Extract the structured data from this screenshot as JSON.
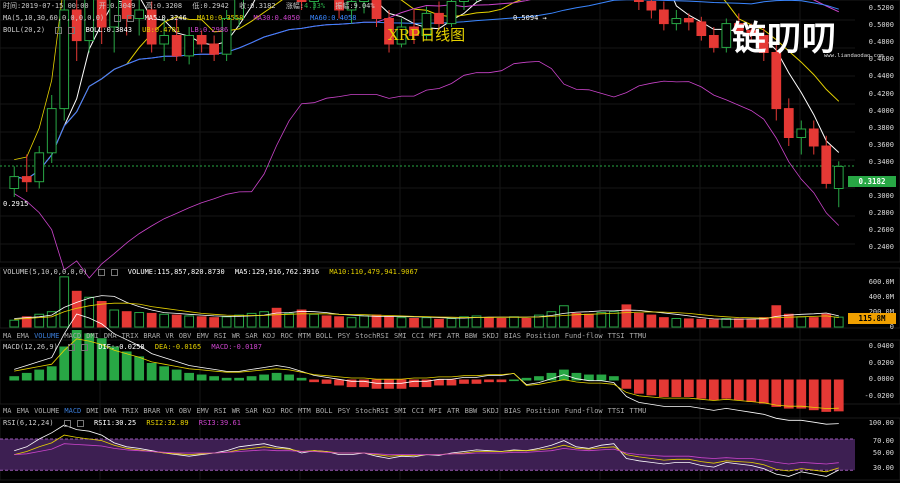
{
  "title": "XRP日线图",
  "logo": {
    "text": "链叨叨",
    "url": "www.liandaodao.com"
  },
  "header": {
    "time_label": "时间:2019-07-15 00:00",
    "open": "开:0.3049",
    "high": "高:0.3208",
    "low": "低:0.2942",
    "close": "收:0.3182",
    "change_label": "涨幅:",
    "change_value": "4.33%",
    "amplitude": "振幅:9.04%"
  },
  "ma_header": {
    "name": "MA(5,10,30,60,0,0,0,0,0)",
    "ma5": "MA5:0.3246",
    "ma10": "MA10:0.3558",
    "ma30": "MA30:0.4050",
    "ma60": "MA60:0.4058"
  },
  "boll_header": {
    "name": "BOLL(20,2)",
    "boll": "BOLL:0.3843",
    "ub": "UB:0.4701",
    "lb": "LB:0.2986"
  },
  "price_axis": [
    "0.5200",
    "0.5000",
    "0.4800",
    "0.4600",
    "0.4400",
    "0.4200",
    "0.4000",
    "0.3800",
    "0.3600",
    "0.3400",
    "0.3200",
    "0.3000",
    "0.2800",
    "0.2600",
    "0.2400"
  ],
  "price_tag": "0.3182",
  "annotations": {
    "high": "0.5094 →",
    "low": "0.2915"
  },
  "volume_header": {
    "name": "VOLUME(5,10,0,0,0,0)",
    "volume": "VOLUME:115,857,820.8730",
    "ma5": "MA5:129,916,762.3916",
    "ma10": "MA10:110,479,941.9067"
  },
  "volume_axis": [
    "600.0M",
    "400.0M",
    "200.0M",
    "0"
  ],
  "volume_tag": "115.8M",
  "indicator_tabs_1": {
    "items": [
      "MA",
      "EMA",
      "VOLUME",
      "MACD",
      "DMI",
      "DMA",
      "TRIX",
      "BRAR",
      "VR",
      "OBV",
      "EMV",
      "RSI",
      "WR",
      "SAR",
      "KDJ",
      "ROC",
      "MTM",
      "BOLL",
      "PSY",
      "StochRSI",
      "SMI",
      "CCI",
      "MFI",
      "ATR",
      "BBW",
      "SKDJ",
      "BIAS",
      "Position",
      "Fund-flow",
      "TTSI",
      "TTMU"
    ],
    "active": "VOLUME"
  },
  "macd_header": {
    "name": "MACD(12,26,9)",
    "dif": "DIF:-0.0258",
    "dea": "DEA:-0.0165",
    "macd": "MACD:-0.0187"
  },
  "macd_axis": [
    "0.0400",
    "0.0200",
    "0.0000",
    "-0.0200"
  ],
  "indicator_tabs_2": {
    "items": [
      "MA",
      "EMA",
      "VOLUME",
      "MACD",
      "DMI",
      "DMA",
      "TRIX",
      "BRAR",
      "VR",
      "OBV",
      "EMV",
      "RSI",
      "WR",
      "SAR",
      "KDJ",
      "ROC",
      "MTM",
      "BOLL",
      "PSY",
      "StochRSI",
      "SMI",
      "CCI",
      "MFI",
      "ATR",
      "BBW",
      "SKDJ",
      "BIAS",
      "Position",
      "Fund-flow",
      "TTSI",
      "TTMU"
    ],
    "active": "MACD"
  },
  "rsi_header": {
    "name": "RSI(6,12,24)",
    "rsi1": "RSI1:30.25",
    "rsi2": "RSI2:32.89",
    "rsi3": "RSI3:39.61"
  },
  "rsi_axis": [
    "100.00",
    "70.00",
    "50.00",
    "30.00"
  ],
  "colors": {
    "up": "#28a745",
    "down": "#e53935",
    "ma5": "#ffffff",
    "ma10": "#e6d200",
    "ma30": "#cc44cc",
    "ma60": "#3a86ff",
    "rsi_band": "#3d1f52"
  },
  "chart_data": {
    "type": "candlestick",
    "dates_last": "2019-07-15",
    "candles": [
      [
        0.305,
        0.318,
        0.3,
        0.312
      ],
      [
        0.312,
        0.325,
        0.303,
        0.309
      ],
      [
        0.309,
        0.33,
        0.305,
        0.326
      ],
      [
        0.326,
        0.36,
        0.32,
        0.352
      ],
      [
        0.352,
        0.42,
        0.345,
        0.41
      ],
      [
        0.41,
        0.44,
        0.38,
        0.392
      ],
      [
        0.392,
        0.47,
        0.385,
        0.455
      ],
      [
        0.455,
        0.465,
        0.39,
        0.4
      ],
      [
        0.4,
        0.425,
        0.385,
        0.42
      ],
      [
        0.42,
        0.43,
        0.395,
        0.405
      ],
      [
        0.405,
        0.42,
        0.395,
        0.41
      ],
      [
        0.41,
        0.415,
        0.385,
        0.39
      ],
      [
        0.39,
        0.405,
        0.38,
        0.395
      ],
      [
        0.395,
        0.405,
        0.38,
        0.383
      ],
      [
        0.383,
        0.4,
        0.378,
        0.395
      ],
      [
        0.395,
        0.398,
        0.385,
        0.39
      ],
      [
        0.39,
        0.395,
        0.38,
        0.384
      ],
      [
        0.384,
        0.41,
        0.38,
        0.405
      ],
      [
        0.405,
        0.44,
        0.4,
        0.432
      ],
      [
        0.432,
        0.46,
        0.425,
        0.45
      ],
      [
        0.45,
        0.47,
        0.44,
        0.462
      ],
      [
        0.462,
        0.48,
        0.43,
        0.44
      ],
      [
        0.44,
        0.455,
        0.43,
        0.448
      ],
      [
        0.448,
        0.45,
        0.41,
        0.415
      ],
      [
        0.415,
        0.435,
        0.41,
        0.43
      ],
      [
        0.43,
        0.44,
        0.42,
        0.425
      ],
      [
        0.425,
        0.43,
        0.405,
        0.41
      ],
      [
        0.41,
        0.42,
        0.402,
        0.415
      ],
      [
        0.415,
        0.425,
        0.408,
        0.42
      ],
      [
        0.42,
        0.425,
        0.4,
        0.405
      ],
      [
        0.405,
        0.41,
        0.385,
        0.39
      ],
      [
        0.39,
        0.405,
        0.388,
        0.4
      ],
      [
        0.4,
        0.41,
        0.39,
        0.395
      ],
      [
        0.395,
        0.412,
        0.392,
        0.408
      ],
      [
        0.408,
        0.415,
        0.398,
        0.402
      ],
      [
        0.402,
        0.418,
        0.4,
        0.415
      ],
      [
        0.415,
        0.425,
        0.41,
        0.42
      ],
      [
        0.42,
        0.432,
        0.415,
        0.428
      ],
      [
        0.428,
        0.44,
        0.422,
        0.425
      ],
      [
        0.425,
        0.432,
        0.418,
        0.422
      ],
      [
        0.422,
        0.435,
        0.42,
        0.43
      ],
      [
        0.43,
        0.438,
        0.425,
        0.428
      ],
      [
        0.428,
        0.45,
        0.425,
        0.445
      ],
      [
        0.445,
        0.47,
        0.44,
        0.462
      ],
      [
        0.462,
        0.509,
        0.455,
        0.49
      ],
      [
        0.49,
        0.495,
        0.47,
        0.475
      ],
      [
        0.475,
        0.485,
        0.465,
        0.47
      ],
      [
        0.47,
        0.495,
        0.468,
        0.488
      ],
      [
        0.488,
        0.5,
        0.48,
        0.495
      ],
      [
        0.495,
        0.5,
        0.42,
        0.43
      ],
      [
        0.43,
        0.435,
        0.41,
        0.415
      ],
      [
        0.415,
        0.42,
        0.405,
        0.41
      ],
      [
        0.41,
        0.415,
        0.398,
        0.402
      ],
      [
        0.402,
        0.41,
        0.398,
        0.405
      ],
      [
        0.405,
        0.408,
        0.398,
        0.403
      ],
      [
        0.403,
        0.406,
        0.392,
        0.395
      ],
      [
        0.395,
        0.4,
        0.385,
        0.388
      ],
      [
        0.388,
        0.405,
        0.385,
        0.402
      ],
      [
        0.402,
        0.408,
        0.395,
        0.398
      ],
      [
        0.398,
        0.402,
        0.392,
        0.395
      ],
      [
        0.395,
        0.4,
        0.38,
        0.385
      ],
      [
        0.385,
        0.39,
        0.345,
        0.352
      ],
      [
        0.352,
        0.358,
        0.33,
        0.335
      ],
      [
        0.335,
        0.345,
        0.325,
        0.34
      ],
      [
        0.34,
        0.345,
        0.325,
        0.33
      ],
      [
        0.33,
        0.336,
        0.305,
        0.308
      ],
      [
        0.305,
        0.321,
        0.294,
        0.318
      ]
    ],
    "volume_m": [
      80,
      120,
      150,
      180,
      590,
      420,
      350,
      300,
      200,
      180,
      170,
      160,
      150,
      140,
      130,
      120,
      110,
      120,
      140,
      160,
      180,
      220,
      160,
      200,
      150,
      130,
      120,
      110,
      130,
      140,
      120,
      110,
      100,
      110,
      90,
      100,
      120,
      130,
      110,
      100,
      120,
      100,
      140,
      180,
      250,
      160,
      150,
      170,
      180,
      260,
      160,
      140,
      110,
      100,
      95,
      90,
      85,
      100,
      95,
      90,
      110,
      250,
      150,
      120,
      110,
      150,
      116
    ],
    "volume_ma5_m": [
      100,
      110,
      120,
      140,
      230,
      290,
      340,
      370,
      360,
      290,
      240,
      200,
      170,
      160,
      150,
      140,
      130,
      125,
      125,
      130,
      140,
      165,
      170,
      185,
      180,
      170,
      150,
      140,
      130,
      125,
      125,
      122,
      120,
      118,
      110,
      105,
      105,
      112,
      115,
      115,
      115,
      115,
      120,
      135,
      160,
      175,
      180,
      190,
      190,
      200,
      195,
      180,
      165,
      150,
      130,
      110,
      95,
      92,
      93,
      94,
      95,
      125,
      140,
      150,
      155,
      165,
      130
    ],
    "volume_ma10_m": [
      90,
      100,
      110,
      120,
      180,
      220,
      250,
      270,
      280,
      280,
      270,
      240,
      220,
      200,
      180,
      160,
      150,
      140,
      135,
      135,
      135,
      145,
      150,
      155,
      155,
      155,
      150,
      148,
      145,
      140,
      135,
      130,
      125,
      122,
      118,
      115,
      112,
      113,
      114,
      115,
      115,
      115,
      118,
      125,
      135,
      145,
      150,
      155,
      160,
      170,
      175,
      178,
      175,
      170,
      160,
      145,
      130,
      120,
      112,
      108,
      105,
      110,
      115,
      120,
      125,
      130,
      110
    ],
    "macd_hist": [
      0.002,
      0.004,
      0.006,
      0.008,
      0.02,
      0.03,
      0.028,
      0.025,
      0.02,
      0.017,
      0.014,
      0.01,
      0.008,
      0.006,
      0.004,
      0.003,
      0.002,
      0.001,
      0.001,
      0.002,
      0.003,
      0.004,
      0.003,
      0.001,
      -0.001,
      -0.002,
      -0.003,
      -0.004,
      -0.004,
      -0.005,
      -0.005,
      -0.005,
      -0.004,
      -0.004,
      -0.003,
      -0.003,
      -0.002,
      -0.002,
      -0.001,
      -0.001,
      0.0,
      0.001,
      0.002,
      0.004,
      0.006,
      0.004,
      0.003,
      0.003,
      0.002,
      -0.005,
      -0.008,
      -0.009,
      -0.01,
      -0.01,
      -0.01,
      -0.011,
      -0.012,
      -0.011,
      -0.012,
      -0.013,
      -0.014,
      -0.016,
      -0.017,
      -0.017,
      -0.018,
      -0.019,
      -0.0187
    ],
    "rsi1": [
      55,
      60,
      70,
      78,
      88,
      82,
      80,
      75,
      65,
      60,
      58,
      55,
      52,
      50,
      48,
      50,
      52,
      55,
      60,
      62,
      64,
      60,
      58,
      52,
      55,
      54,
      50,
      50,
      52,
      48,
      45,
      48,
      47,
      50,
      49,
      52,
      54,
      56,
      55,
      54,
      56,
      55,
      58,
      62,
      68,
      60,
      58,
      62,
      64,
      45,
      42,
      40,
      38,
      40,
      40,
      36,
      34,
      40,
      38,
      36,
      32,
      25,
      22,
      28,
      25,
      22,
      30.25
    ],
    "rsi2": [
      50,
      54,
      60,
      65,
      75,
      72,
      70,
      68,
      62,
      58,
      56,
      54,
      52,
      51,
      50,
      51,
      52,
      53,
      56,
      58,
      60,
      58,
      57,
      54,
      55,
      54,
      52,
      52,
      52,
      50,
      48,
      49,
      49,
      50,
      50,
      51,
      52,
      54,
      54,
      54,
      55,
      55,
      56,
      58,
      62,
      58,
      57,
      59,
      60,
      50,
      47,
      45,
      43,
      44,
      44,
      41,
      39,
      42,
      41,
      40,
      37,
      31,
      29,
      32,
      30,
      28,
      32.89
    ],
    "rsi3": [
      50,
      51,
      54,
      57,
      64,
      63,
      62,
      61,
      58,
      56,
      55,
      54,
      53,
      52,
      52,
      52,
      52,
      53,
      54,
      55,
      56,
      55,
      55,
      54,
      54,
      53,
      52,
      52,
      52,
      51,
      50,
      50,
      50,
      50,
      50,
      51,
      51,
      52,
      52,
      52,
      53,
      53,
      54,
      55,
      58,
      56,
      55,
      56,
      57,
      52,
      50,
      49,
      48,
      48,
      48,
      46,
      45,
      46,
      45,
      45,
      43,
      40,
      38,
      40,
      39,
      38,
      39.61
    ]
  }
}
